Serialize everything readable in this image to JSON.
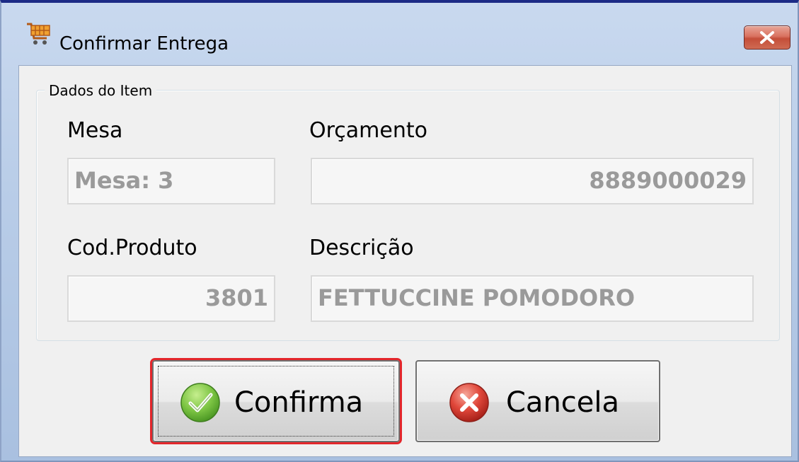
{
  "window": {
    "title": "Confirmar Entrega",
    "icon": "shopping-cart-icon",
    "close_icon": "close-icon"
  },
  "group": {
    "legend": "Dados do Item"
  },
  "fields": {
    "mesa": {
      "label": "Mesa",
      "value": "Mesa: 3"
    },
    "orcamento": {
      "label": "Orçamento",
      "value": "8889000029"
    },
    "cod_produto": {
      "label": "Cod.Produto",
      "value": "3801"
    },
    "descricao": {
      "label": "Descrição",
      "value": "FETTUCCINE POMODORO"
    }
  },
  "buttons": {
    "confirma": {
      "label": "Confirma",
      "icon": "check-icon"
    },
    "cancela": {
      "label": "Cancela",
      "icon": "x-circle-icon"
    }
  },
  "colors": {
    "title_border": "#1c2b86",
    "focus_outline": "#e3262b",
    "disabled_text": "#9a9a9a",
    "check_green": "#6ab83a",
    "cancel_red": "#d2322b"
  }
}
